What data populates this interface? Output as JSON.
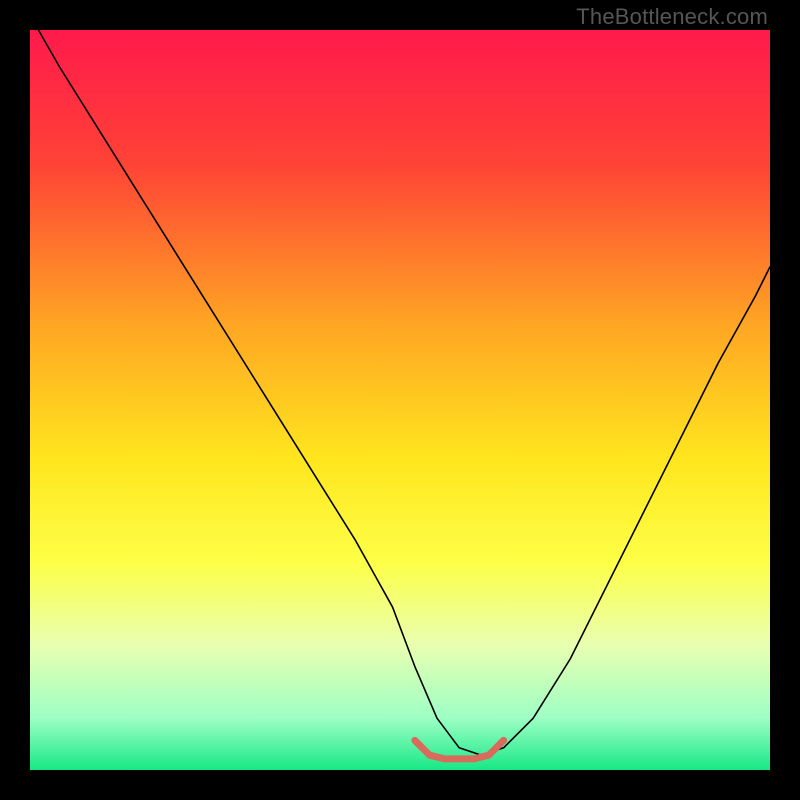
{
  "watermark": "TheBottleneck.com",
  "chart_data": {
    "type": "line",
    "title": "",
    "xlabel": "",
    "ylabel": "",
    "xlim": [
      0,
      100
    ],
    "ylim": [
      0,
      100
    ],
    "gradient_stops": [
      {
        "offset": 0,
        "color": "#ff1a4b"
      },
      {
        "offset": 18,
        "color": "#ff4236"
      },
      {
        "offset": 40,
        "color": "#ffa623"
      },
      {
        "offset": 58,
        "color": "#ffe61e"
      },
      {
        "offset": 72,
        "color": "#fdff47"
      },
      {
        "offset": 83,
        "color": "#e9ffb0"
      },
      {
        "offset": 93,
        "color": "#9dffc5"
      },
      {
        "offset": 100,
        "color": "#17e886"
      }
    ],
    "series": [
      {
        "name": "bottleneck-curve",
        "color": "#000000",
        "width": 1.6,
        "x": [
          0,
          4,
          9,
          14,
          19,
          24,
          29,
          34,
          39,
          44,
          49,
          52,
          55,
          58,
          61,
          64,
          68,
          73,
          78,
          83,
          88,
          93,
          98,
          100
        ],
        "values": [
          102,
          95,
          87,
          79,
          71,
          63,
          55,
          47,
          39,
          31,
          22,
          14,
          7,
          3,
          2,
          3,
          7,
          15,
          25,
          35,
          45,
          55,
          64,
          68
        ]
      },
      {
        "name": "sweet-spot",
        "color": "#d96b5c",
        "width": 7,
        "x": [
          52,
          54,
          56,
          58,
          60,
          62,
          64
        ],
        "values": [
          4,
          2,
          1.5,
          1.5,
          1.5,
          2,
          4
        ]
      }
    ]
  }
}
